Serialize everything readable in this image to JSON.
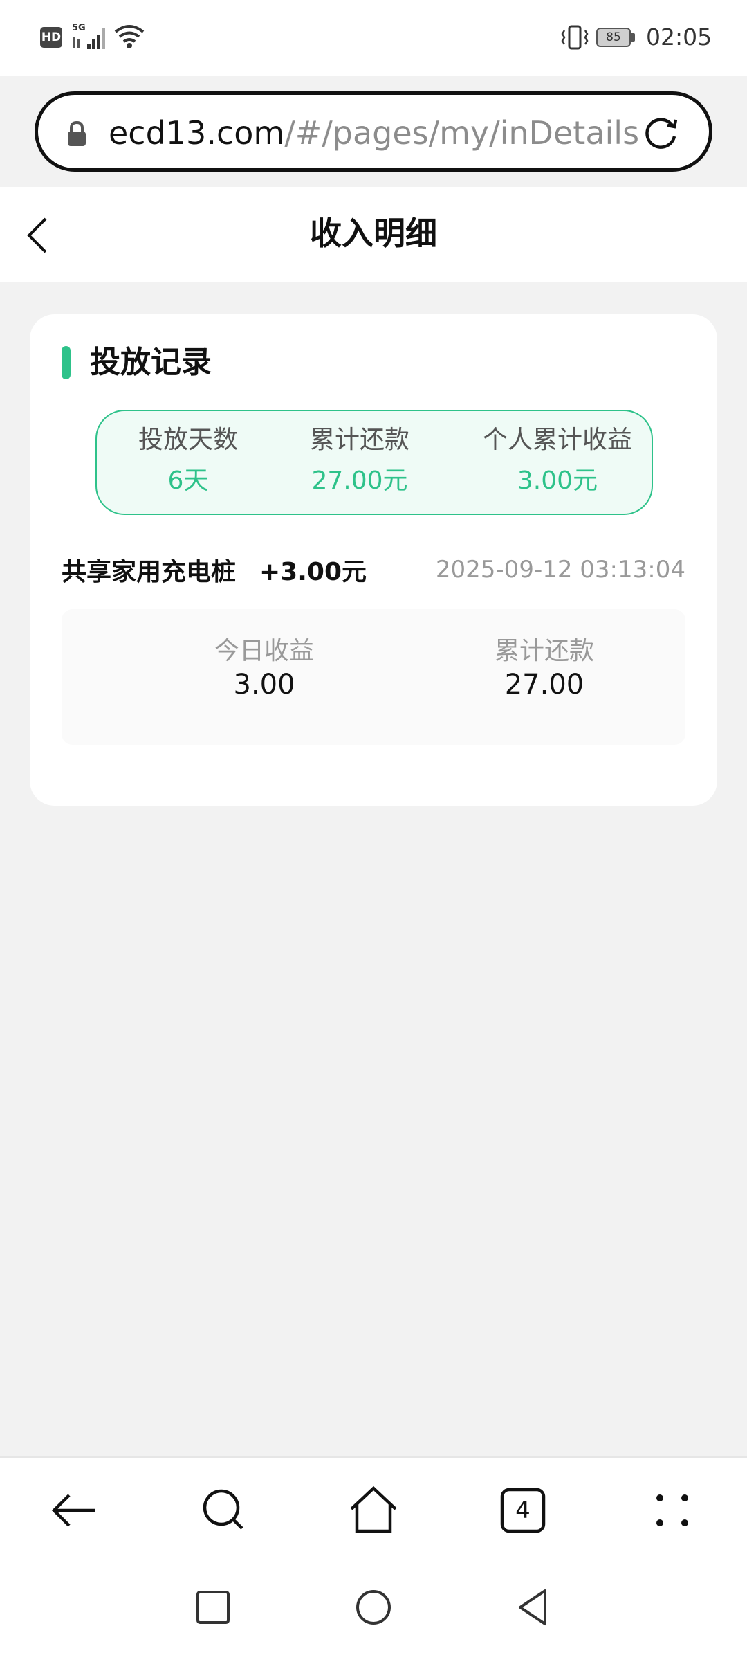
{
  "status_bar": {
    "hd_label": "HD",
    "network_label": "5G",
    "battery_level": "85",
    "time": "02:05",
    "icons": [
      "hd-icon",
      "cellular-signal-icon",
      "wifi-icon",
      "vibrate-icon",
      "battery-icon"
    ]
  },
  "address_bar": {
    "url_host": "ecd13.com",
    "url_path": "/#/pages/my/inDetails",
    "icons": [
      "lock-icon",
      "reload-icon"
    ]
  },
  "header": {
    "title": "收入明细",
    "back_icon": "chevron-left-icon"
  },
  "record_card": {
    "title": "投放记录",
    "accent_color": "#2ec28a",
    "summary": [
      {
        "label": "投放天数",
        "value": "6天"
      },
      {
        "label": "累计还款",
        "value": "27.00元"
      },
      {
        "label": "个人累计收益",
        "value": "3.00元"
      }
    ],
    "records": [
      {
        "name": "共享家用充电桩",
        "amount": "+3.00元",
        "time": "2025-09-12 03:13:04",
        "details": [
          {
            "label": "今日收益",
            "value": "3.00"
          },
          {
            "label": "累计还款",
            "value": "27.00"
          }
        ]
      }
    ]
  },
  "browser_toolbar": {
    "tab_count": "4",
    "icons": [
      "arrow-left-icon",
      "search-icon",
      "home-icon",
      "tabs-icon",
      "more-icon"
    ]
  },
  "system_nav": {
    "icons": [
      "recents-square-icon",
      "home-circle-icon",
      "back-triangle-icon"
    ]
  }
}
